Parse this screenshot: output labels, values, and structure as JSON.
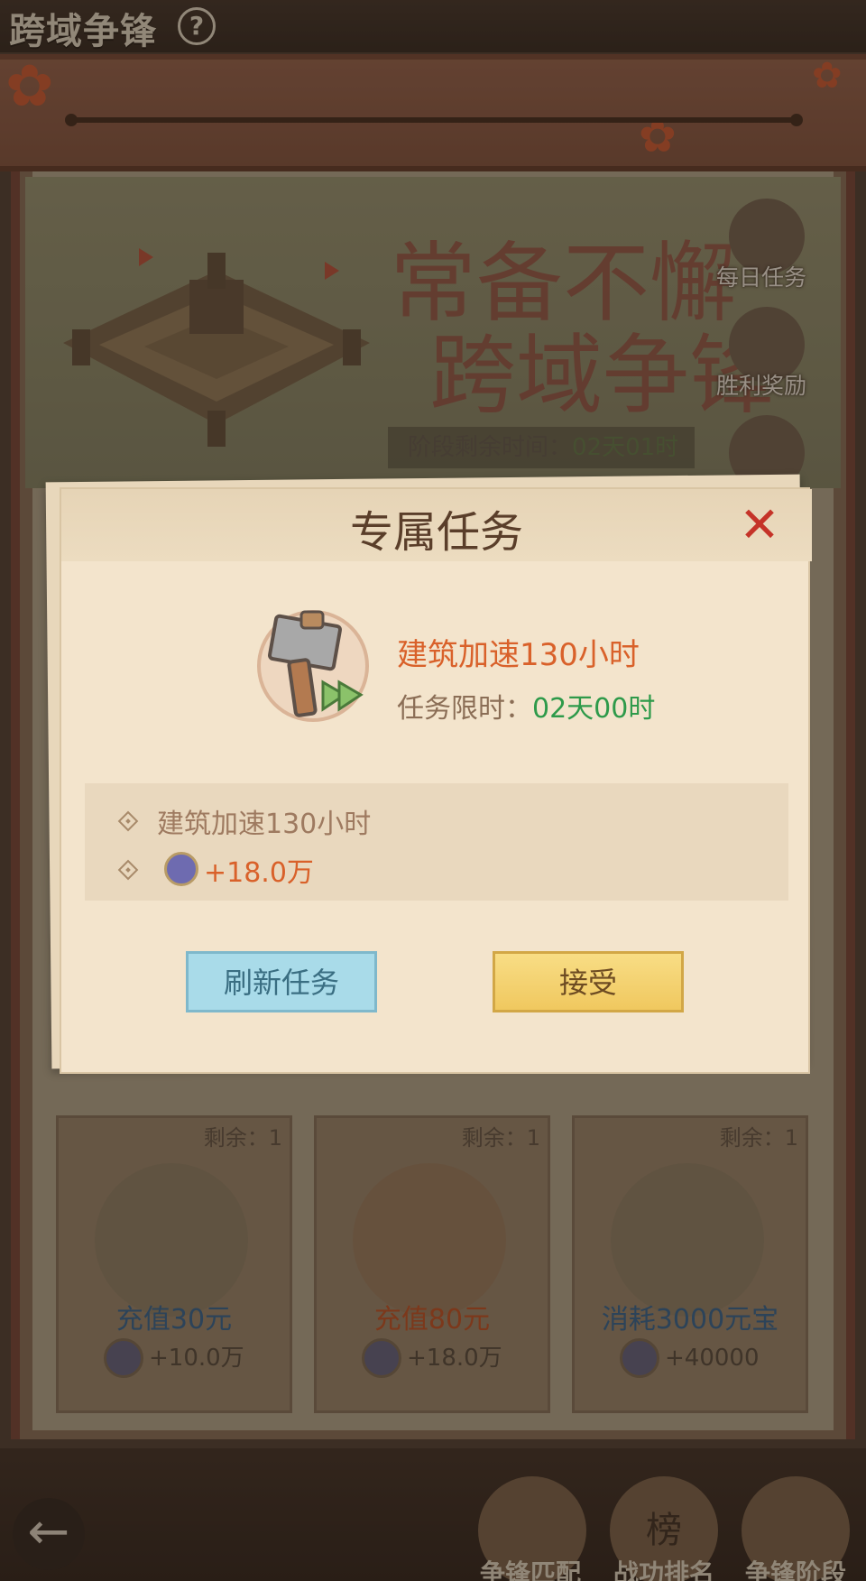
{
  "topbar": {
    "title": "跨域争锋",
    "help_icon": "question-icon"
  },
  "hero": {
    "slogan_line1": "常备不懈",
    "slogan_line2": "跨域争锋",
    "phase_label": "阶段剩余时间：",
    "phase_time": "02天01时",
    "side_buttons": [
      {
        "label": "每日任务",
        "icon": "chest-icon"
      },
      {
        "label": "胜利奖励",
        "icon": "reward-chest-icon"
      },
      {
        "label": "",
        "icon": "scroll-icon"
      }
    ]
  },
  "cards": [
    {
      "remain": "剩余：1",
      "name": "充值30元",
      "value": "+10.0万",
      "name_color": "#2f5c86"
    },
    {
      "remain": "剩余：1",
      "name": "充值80元",
      "value": "+18.0万",
      "name_color": "#b44a1f"
    },
    {
      "remain": "剩余：1",
      "name": "消耗3000元宝",
      "value": "+40000",
      "name_color": "#2f5c86"
    }
  ],
  "bottom_nav": [
    {
      "label": "争锋匹配",
      "icon": "soldiers-icon"
    },
    {
      "label": "战功排名",
      "icon": "ranking-board-icon"
    },
    {
      "label": "争锋阶段",
      "icon": "map-scroll-icon"
    }
  ],
  "bottom_nav_badge": "榜",
  "back_icon": "arrow-left-icon",
  "dialog": {
    "title": "专属任务",
    "close_icon": "close-icon",
    "task_icon": "hammer-speedup-icon",
    "task_name": "建筑加速130小时",
    "time_label": "任务限时：",
    "time_value": "02天00时",
    "rewards": [
      {
        "text": "建筑加速130小时",
        "icon": "diamond-bullet-icon"
      },
      {
        "text": "+18.0万",
        "icon": "coin-icon"
      }
    ],
    "refresh_button": "刷新任务",
    "accept_button": "接受"
  },
  "colors": {
    "accent_orange": "#d9612a",
    "timer_green": "#2e9a4a",
    "close_red": "#c53328"
  }
}
